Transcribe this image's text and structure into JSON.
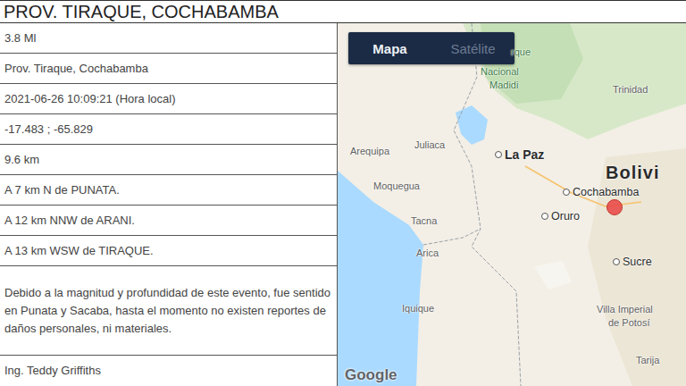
{
  "title": "PROV. TIRAQUE, COCHABAMBA",
  "details": [
    "3.8 Ml",
    "Prov. Tiraque, Cochabamba",
    "2021-06-26 10:09:21 (Hora local)",
    "-17.483 ; -65.829",
    "9.6 km",
    "A 7 km N de PUNATA.",
    "A 12 km NNW de ARANI.",
    "A 13 km WSW de TIRAQUE."
  ],
  "description": "Debido a la magnitud y profundidad de este evento, fue sentido en Punata y Sacaba, hasta el momento no existen reportes de daños personales, ni materiales.",
  "author": "Ing. Teddy Griffiths",
  "map": {
    "tabs": [
      {
        "label": "Mapa",
        "selected": true
      },
      {
        "label": "Satélite",
        "selected": false
      }
    ],
    "places": [
      {
        "name": "rque",
        "kind": "park"
      },
      {
        "name": "Nacional",
        "kind": "park"
      },
      {
        "name": "Madidi",
        "kind": "park"
      },
      {
        "name": "Trinidad",
        "kind": "city"
      },
      {
        "name": "Juliaca",
        "kind": "city"
      },
      {
        "name": "La Paz",
        "kind": "capital"
      },
      {
        "name": "Arequipa",
        "kind": "city"
      },
      {
        "name": "Bolivi",
        "kind": "country"
      },
      {
        "name": "Cochabamba",
        "kind": "major"
      },
      {
        "name": "Moquegua",
        "kind": "city"
      },
      {
        "name": "Oruro",
        "kind": "major"
      },
      {
        "name": "Tacna",
        "kind": "city"
      },
      {
        "name": "Arica",
        "kind": "city"
      },
      {
        "name": "Sucre",
        "kind": "major"
      },
      {
        "name": "Iquique",
        "kind": "city"
      },
      {
        "name": "Villa Imperial",
        "kind": "city"
      },
      {
        "name": "de Potosí",
        "kind": "city"
      },
      {
        "name": "Tarija",
        "kind": "city"
      }
    ],
    "attribution": "Google"
  }
}
